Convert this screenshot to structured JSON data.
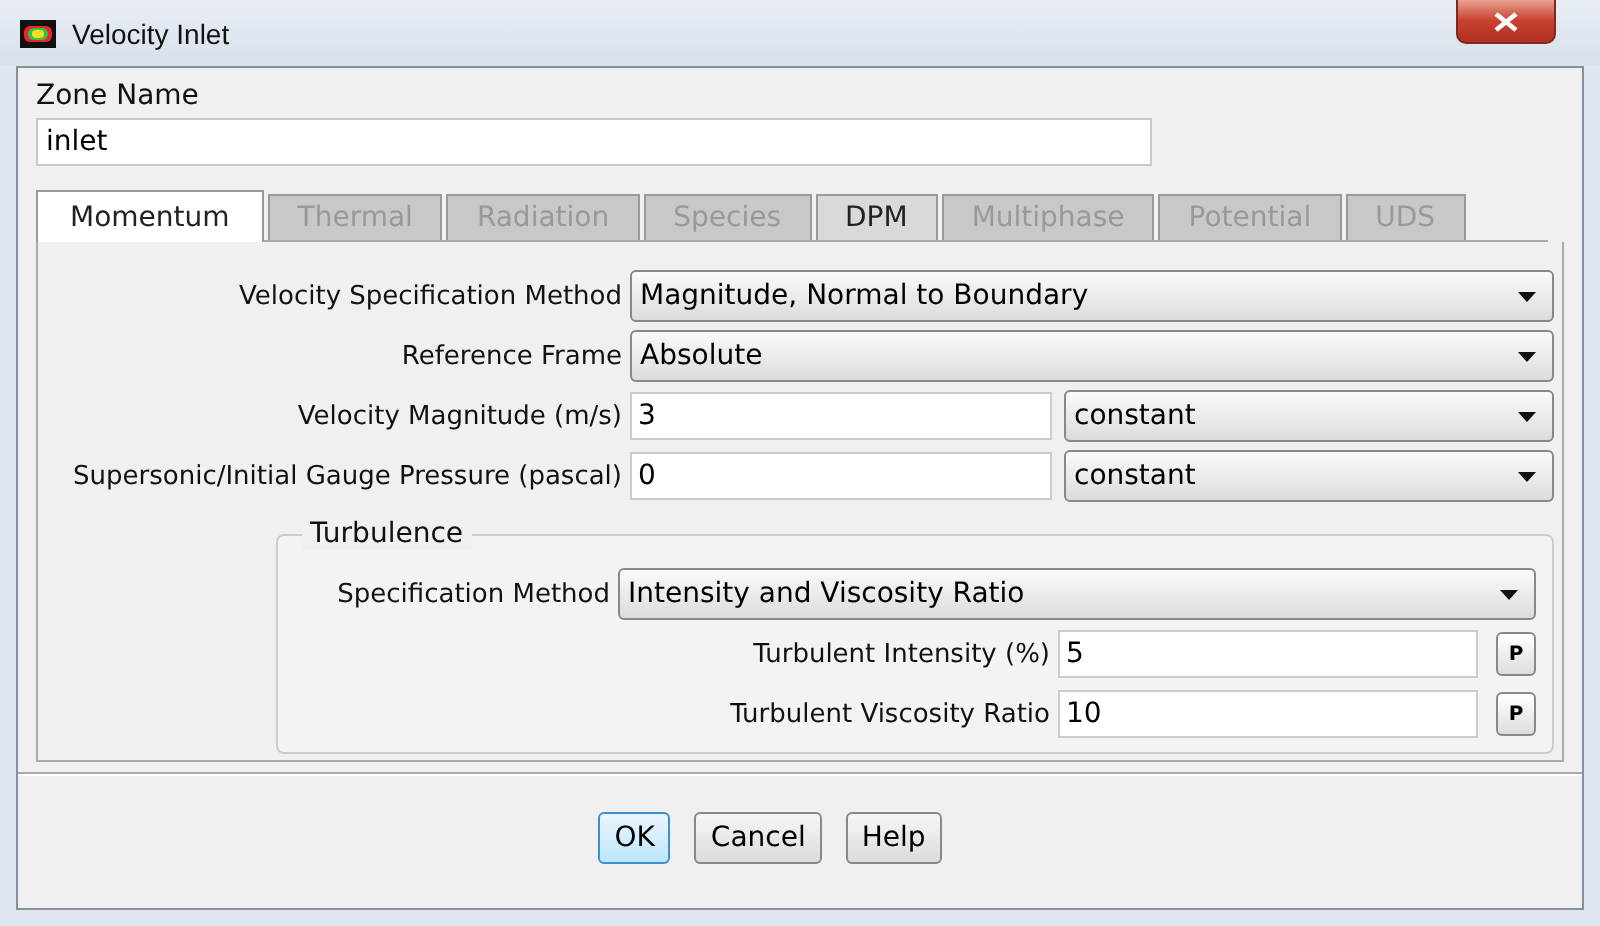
{
  "window": {
    "title": "Velocity Inlet"
  },
  "zone_name": {
    "label": "Zone Name",
    "value": "inlet"
  },
  "tabs": [
    {
      "label": "Momentum",
      "selected": true,
      "disabled": false
    },
    {
      "label": "Thermal",
      "selected": false,
      "disabled": true
    },
    {
      "label": "Radiation",
      "selected": false,
      "disabled": true
    },
    {
      "label": "Species",
      "selected": false,
      "disabled": true
    },
    {
      "label": "DPM",
      "selected": false,
      "disabled": false
    },
    {
      "label": "Multiphase",
      "selected": false,
      "disabled": true
    },
    {
      "label": "Potential",
      "selected": false,
      "disabled": true
    },
    {
      "label": "UDS",
      "selected": false,
      "disabled": true
    }
  ],
  "fields": [
    {
      "kind": "dropdown",
      "label": "Velocity Specification Method",
      "value": "Magnitude, Normal to Boundary"
    },
    {
      "kind": "dropdown",
      "label": "Reference Frame",
      "value": "Absolute"
    },
    {
      "kind": "value",
      "label": "Velocity Magnitude (m/s)",
      "value": "3",
      "method": "constant"
    },
    {
      "kind": "value",
      "label": "Supersonic/Initial Gauge Pressure (pascal)",
      "value": "0",
      "method": "constant"
    }
  ],
  "turbulence": {
    "title": "Turbulence",
    "fields": [
      {
        "kind": "dropdown",
        "label": "Specification Method",
        "value": "Intensity and Viscosity Ratio"
      },
      {
        "kind": "param",
        "label": "Turbulent Intensity (%)",
        "value": "5",
        "button": "P"
      },
      {
        "kind": "param",
        "label": "Turbulent Viscosity Ratio",
        "value": "10",
        "button": "P"
      }
    ]
  },
  "buttons": [
    {
      "label": "OK",
      "focused": true
    },
    {
      "label": "Cancel",
      "focused": false
    },
    {
      "label": "Help",
      "focused": false
    }
  ]
}
